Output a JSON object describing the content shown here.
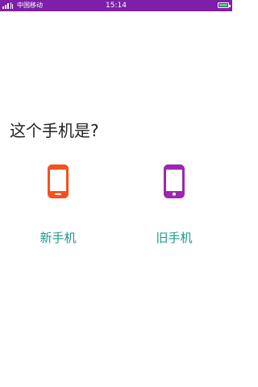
{
  "status_bar": {
    "carrier": "中国移动",
    "time": "15:14",
    "colors": {
      "bar": "#7d1fa8",
      "battery": "#4cd964"
    }
  },
  "main": {
    "question": "这个手机是?",
    "options": [
      {
        "label": "新手机",
        "icon": "phone-icon",
        "icon_color": "#f4511e"
      },
      {
        "label": "旧手机",
        "icon": "phone-icon",
        "icon_color": "#9c27b0"
      }
    ],
    "label_color": "#1a9a8a"
  }
}
